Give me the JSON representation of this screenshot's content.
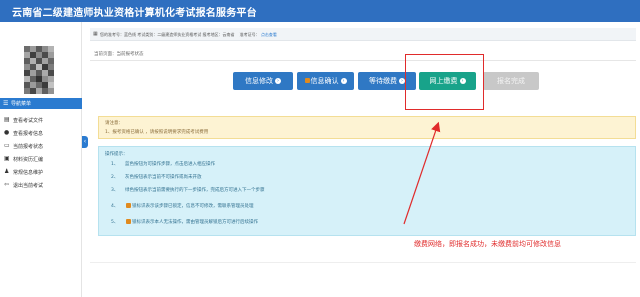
{
  "header": {
    "title": "云南省二级建造师执业资格计算机化考试报名服务平台",
    "bg_color": "#2f6fc0"
  },
  "info_bar": {
    "icon": "id-card-icon",
    "text": "您的准考号：蓝色线   考试类别：二级建造师执业资格考试   报考地区：云南省",
    "tail_label": "准考证号：",
    "tail_value": "点击查看"
  },
  "sidebar": {
    "header": "导航菜单",
    "items": [
      {
        "icon": "file-icon",
        "label": "查看考试文件"
      },
      {
        "icon": "info-icon",
        "label": "查看报考信息"
      },
      {
        "icon": "monitor-icon",
        "label": "当前报考状态"
      },
      {
        "icon": "folder-icon",
        "label": "材料资历汇编"
      },
      {
        "icon": "users-icon",
        "label": "常规信息维护"
      },
      {
        "icon": "logout-icon",
        "label": "退出当前考试"
      }
    ]
  },
  "breadcrumb": "当前页面：当前报考状态",
  "steps": [
    {
      "label": "信息修改",
      "state": "active"
    },
    {
      "label": "信息确认",
      "state": "active"
    },
    {
      "label": "等待缴费",
      "state": "active"
    },
    {
      "label": "网上缴费",
      "state": "current"
    },
    {
      "label": "报名完成",
      "state": "disabled"
    }
  ],
  "notice": {
    "title": "请注意：",
    "body": "1、报考资格已确认 ，请按照说明要求完成考试费用"
  },
  "ops": {
    "title": "操作提示：",
    "rows": [
      {
        "n": "1、",
        "text": "蓝色按钮为可操作步骤，点击后进入相应操作"
      },
      {
        "n": "2、",
        "text": "灰色按钮表示当前不可操作或尚未开放"
      },
      {
        "n": "3、",
        "text": "绿色按钮表示当前需要执行的下一步操作，完成后方可进入下一个步骤"
      },
      {
        "n": "4、",
        "text": "锁标识表示该步骤已锁定，信息不可修改，需联系管理员处理"
      },
      {
        "n": "5、",
        "text": "锁标识表示本人无法操作，需由管理员解锁后方可进行后续操作"
      }
    ]
  },
  "annotation": "缴费网络，即报名成功，未缴费前均可修改信息",
  "colors": {
    "blue": "#2f78c4",
    "green": "#18a38a",
    "disabled": "#c8c8c8",
    "red": "#e02b2b"
  }
}
